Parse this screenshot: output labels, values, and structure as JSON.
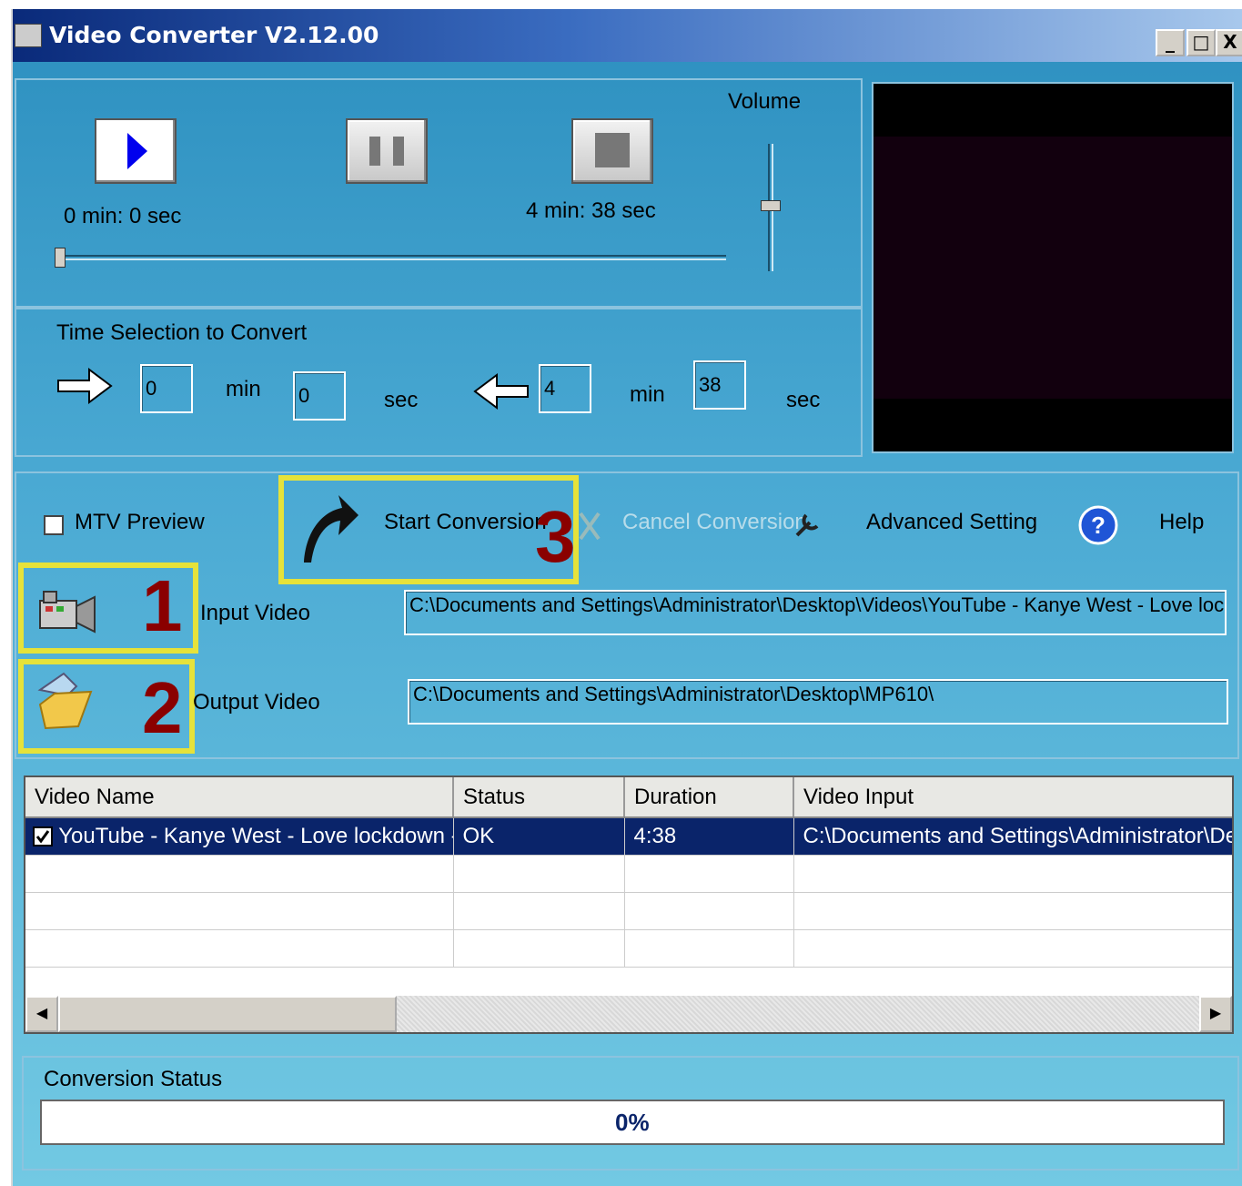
{
  "window": {
    "title": "Video Converter V2.12.00",
    "buttons": {
      "minimize": "_",
      "maximize": "□",
      "close": "X"
    }
  },
  "player": {
    "current_time": "0 min: 0 sec",
    "total_time": "4 min: 38 sec",
    "volume_label": "Volume",
    "position_fraction": 0.0
  },
  "time_selection": {
    "label": "Time Selection to Convert",
    "start_min": "0",
    "start_sec": "0",
    "end_min": "4",
    "end_sec": "38",
    "min_label": "min",
    "sec_label": "sec"
  },
  "toolbar": {
    "mtv_preview": "MTV Preview",
    "start_conversion": "Start Conversion",
    "cancel_conversion": "Cancel Conversion",
    "advanced_setting": "Advanced Setting",
    "help": "Help"
  },
  "annotations": {
    "one": "1",
    "two": "2",
    "three": "3"
  },
  "io": {
    "input_label": "Input Video",
    "input_path": "C:\\Documents and Settings\\Administrator\\Desktop\\Videos\\YouTube - Kanye West - Love lockdown",
    "output_label": "Output Video",
    "output_path": "C:\\Documents and Settings\\Administrator\\Desktop\\MP610\\"
  },
  "list": {
    "columns": [
      "Video Name",
      "Status",
      "Duration",
      "Video Input"
    ],
    "rows": [
      {
        "name": "YouTube - Kanye West - Love lockdown - HD...",
        "status": "OK",
        "duration": "4:38",
        "input": "C:\\Documents and Settings\\Administrator\\Desktop\\V"
      }
    ]
  },
  "status": {
    "label": "Conversion Status",
    "progress_text": "0%",
    "progress": 0
  },
  "colors": {
    "highlight": "#e6e23a",
    "selection": "#0a246a",
    "annotation_number": "#8a0000"
  }
}
